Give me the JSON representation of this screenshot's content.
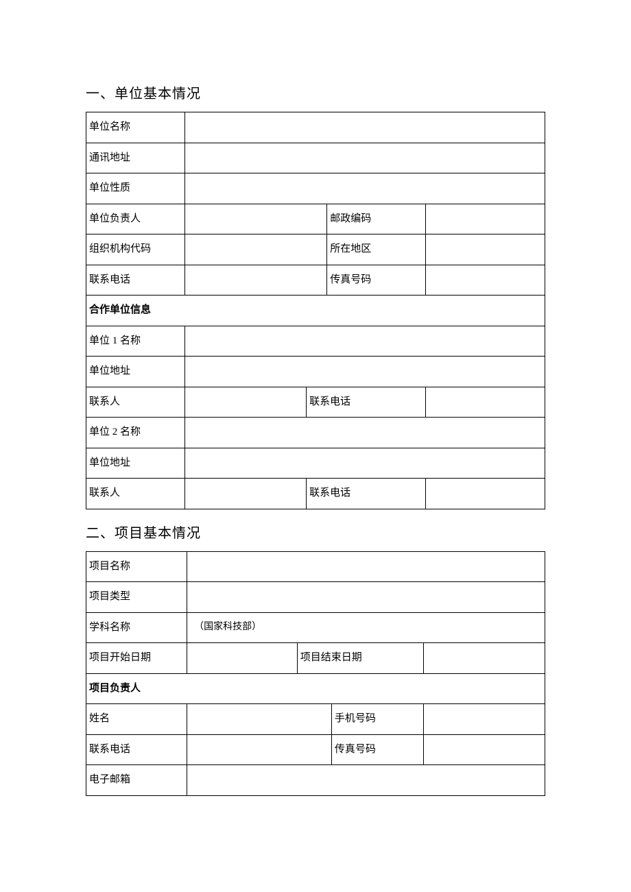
{
  "section1": {
    "title": "一、单位基本情况",
    "labels": {
      "unit_name": "单位名称",
      "address": "通讯地址",
      "unit_type": "单位性质",
      "unit_head": "单位负责人",
      "postal_code": "邮政编码",
      "org_code": "组织机构代码",
      "region": "所在地区",
      "phone": "联系电话",
      "fax": "传真号码"
    },
    "values": {
      "unit_name": "",
      "address": "",
      "unit_type": "",
      "unit_head": "",
      "postal_code": "",
      "org_code": "",
      "region": "",
      "phone": "",
      "fax": ""
    },
    "coop_heading": "合作单位信息",
    "coop_labels": {
      "unit1_name": "单位 1 名称",
      "unit1_addr": "单位地址",
      "unit2_name": "单位 2 名称",
      "unit2_addr": "单位地址",
      "contact": "联系人",
      "contact_phone": "联系电话"
    },
    "coop_values": {
      "unit1_name": "",
      "unit1_addr": "",
      "unit1_contact": "",
      "unit1_phone": "",
      "unit2_name": "",
      "unit2_addr": "",
      "unit2_contact": "",
      "unit2_phone": ""
    }
  },
  "section2": {
    "title": "二、项目基本情况",
    "labels": {
      "proj_name": "项目名称",
      "proj_type": "项目类型",
      "subject": "学科名称",
      "subject_note": "（国家科技部）",
      "start_date": "项目开始日期",
      "end_date": "项目结束日期"
    },
    "values": {
      "proj_name": "",
      "proj_type": "",
      "start_date": "",
      "end_date": ""
    },
    "lead_heading": "项目负责人",
    "lead_labels": {
      "name": "姓名",
      "mobile": "手机号码",
      "phone": "联系电话",
      "fax": "传真号码",
      "email": "电子邮箱"
    },
    "lead_values": {
      "name": "",
      "mobile": "",
      "phone": "",
      "fax": "",
      "email": ""
    }
  }
}
